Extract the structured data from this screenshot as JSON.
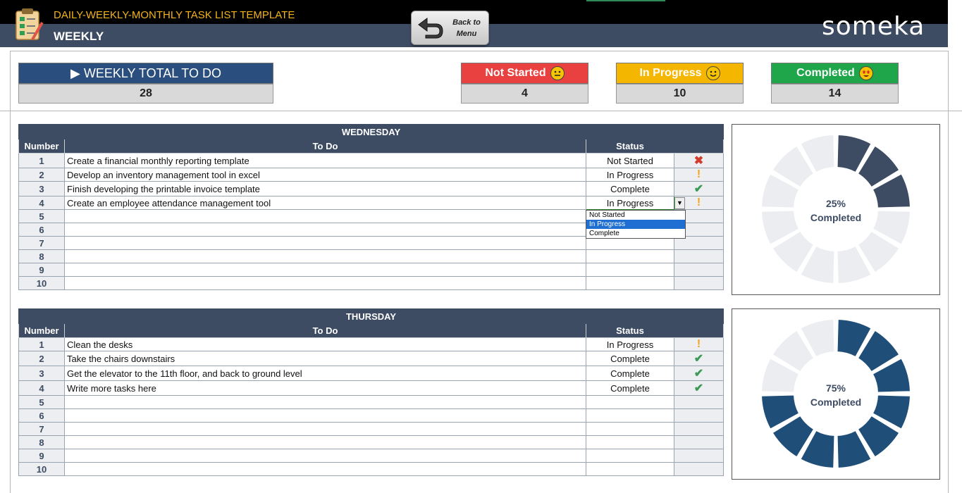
{
  "header": {
    "app_title": "DAILY-WEEKLY-MONTHLY TASK LIST TEMPLATE",
    "view_title": "WEEKLY",
    "back_button": "Back to Menu",
    "back_line1": "Back to",
    "back_line2": "Menu",
    "logo": "someka"
  },
  "summary": {
    "total": {
      "label": "▶ WEEKLY TOTAL TO DO",
      "value": "28",
      "color": "#2a4f7e"
    },
    "not_started": {
      "label": "Not Started",
      "value": "4",
      "color": "#e94040"
    },
    "in_progress": {
      "label": "In Progress",
      "value": "10",
      "color": "#f5b600"
    },
    "completed": {
      "label": "Completed",
      "value": "14",
      "color": "#1fa54a"
    }
  },
  "columns": {
    "number": "Number",
    "todo": "To Do",
    "status": "Status"
  },
  "days": [
    {
      "name": "WEDNESDAY",
      "completed_label": "25%",
      "completed_word": "Completed",
      "completed_fraction": 0.25,
      "chart_color": "#3d4b63",
      "rows": [
        {
          "n": "1",
          "task": "Create a financial monthly reporting template",
          "status": "Not Started",
          "icon": "x-icon"
        },
        {
          "n": "2",
          "task": "Develop an inventory management tool in excel",
          "status": "In Progress",
          "icon": "exclamation-icon"
        },
        {
          "n": "3",
          "task": "Finish developing the printable invoice template",
          "status": "Complete",
          "icon": "check-icon"
        },
        {
          "n": "4",
          "task": "Create an employee attendance management tool",
          "status": "In Progress",
          "icon": "exclamation-icon"
        },
        {
          "n": "5",
          "task": "",
          "status": "",
          "icon": ""
        },
        {
          "n": "6",
          "task": "",
          "status": "",
          "icon": ""
        },
        {
          "n": "7",
          "task": "",
          "status": "",
          "icon": ""
        },
        {
          "n": "8",
          "task": "",
          "status": "",
          "icon": ""
        },
        {
          "n": "9",
          "task": "",
          "status": "",
          "icon": ""
        },
        {
          "n": "10",
          "task": "",
          "status": "",
          "icon": ""
        }
      ]
    },
    {
      "name": "THURSDAY",
      "completed_label": "75%",
      "completed_word": "Completed",
      "completed_fraction": 0.75,
      "chart_color": "#1f4e79",
      "rows": [
        {
          "n": "1",
          "task": "Clean the desks",
          "status": "In Progress",
          "icon": "exclamation-icon"
        },
        {
          "n": "2",
          "task": "Take the chairs downstairs",
          "status": "Complete",
          "icon": "check-icon"
        },
        {
          "n": "3",
          "task": "Get the elevator to the 11th floor, and back to ground level",
          "status": "Complete",
          "icon": "check-icon"
        },
        {
          "n": "4",
          "task": "Write more tasks here",
          "status": "Complete",
          "icon": "check-icon"
        },
        {
          "n": "5",
          "task": "",
          "status": "",
          "icon": ""
        },
        {
          "n": "6",
          "task": "",
          "status": "",
          "icon": ""
        },
        {
          "n": "7",
          "task": "",
          "status": "",
          "icon": ""
        },
        {
          "n": "8",
          "task": "",
          "status": "",
          "icon": ""
        },
        {
          "n": "9",
          "task": "",
          "status": "",
          "icon": ""
        },
        {
          "n": "10",
          "task": "",
          "status": "",
          "icon": ""
        }
      ]
    }
  ],
  "dropdown": {
    "options": [
      "Not Started",
      "In Progress",
      "Complete"
    ],
    "selected": "In Progress"
  }
}
